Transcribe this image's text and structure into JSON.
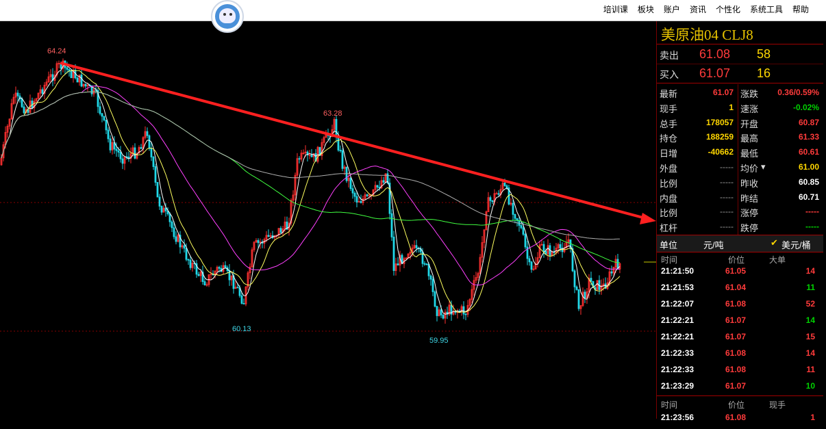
{
  "menu": [
    "培训课",
    "板块",
    "账户",
    "资讯",
    "个性化",
    "系统工具",
    "帮助"
  ],
  "chart": {
    "annotations": {
      "high1": "64.24",
      "high2": "63.28",
      "low1": "60.13",
      "low2": "59.95"
    },
    "colors": {
      "up": "#ff3030",
      "down": "#20d8e8",
      "ma5": "#ffffff",
      "ma10": "#ffff60",
      "ma20": "#ff40ff",
      "ma60": "#40ff40",
      "ma120": "#b0b0b0",
      "trendline": "#ff2020"
    }
  },
  "quote": {
    "title": "美原油04  CLJ8",
    "sell_label": "卖出",
    "sell_price": "61.08",
    "sell_vol": "58",
    "buy_label": "买入",
    "buy_price": "61.07",
    "buy_vol": "16",
    "left": [
      {
        "label": "最新",
        "value": "61.07"
      },
      {
        "label": "现手",
        "value": "1"
      },
      {
        "label": "总手",
        "value": "178057"
      },
      {
        "label": "持仓",
        "value": "188259"
      },
      {
        "label": "日增",
        "value": "-40662"
      },
      {
        "label": "外盘",
        "value": "-----"
      },
      {
        "label": "比例",
        "value": "-----"
      },
      {
        "label": "内盘",
        "value": "-----"
      },
      {
        "label": "比例",
        "value": "-----"
      },
      {
        "label": "杠杆",
        "value": "-----"
      }
    ],
    "right": [
      {
        "label": "涨跌",
        "value": "0.36/0.59%"
      },
      {
        "label": "速涨",
        "value": "-0.02%"
      },
      {
        "label": "开盘",
        "value": "60.87"
      },
      {
        "label": "最高",
        "value": "61.33"
      },
      {
        "label": "最低",
        "value": "60.61"
      },
      {
        "label": "均价",
        "value": "61.00"
      },
      {
        "label": "昨收",
        "value": "60.85"
      },
      {
        "label": "昨结",
        "value": "60.71"
      },
      {
        "label": "涨停",
        "value": "-----"
      },
      {
        "label": "跌停",
        "value": "-----"
      }
    ],
    "unit_label": "单位",
    "unit_option1": "元/吨",
    "unit_option2": "美元/桶",
    "ticks_header": {
      "time": "时间",
      "price": "价位",
      "vol": "大单"
    },
    "ticks": [
      {
        "time": "21:21:50",
        "price": "61.05",
        "vol": "14"
      },
      {
        "time": "21:21:53",
        "price": "61.04",
        "vol": "11"
      },
      {
        "time": "21:22:07",
        "price": "61.08",
        "vol": "52"
      },
      {
        "time": "21:22:21",
        "price": "61.07",
        "vol": "14"
      },
      {
        "time": "21:22:21",
        "price": "61.07",
        "vol": "15"
      },
      {
        "time": "21:22:33",
        "price": "61.08",
        "vol": "14"
      },
      {
        "time": "21:22:33",
        "price": "61.08",
        "vol": "11"
      },
      {
        "time": "21:23:29",
        "price": "61.07",
        "vol": "10"
      }
    ],
    "ticks_header2": {
      "time": "时间",
      "price": "价位",
      "vol": "现手"
    },
    "ticks2": [
      {
        "time": "21:23:56",
        "price": "61.08",
        "vol": "1"
      }
    ]
  }
}
